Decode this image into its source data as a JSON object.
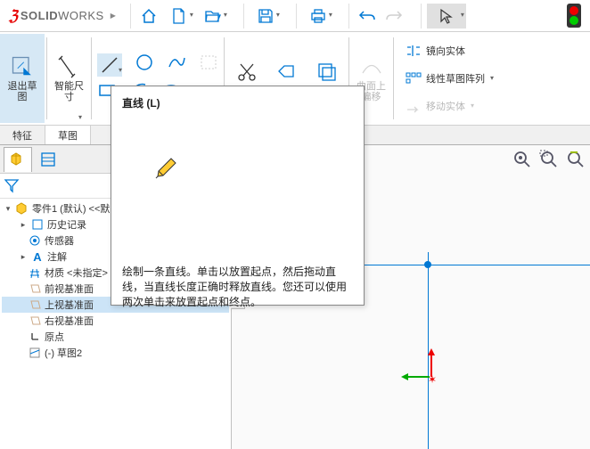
{
  "app": {
    "name_solid": "SOLID",
    "name_works": "WORKS"
  },
  "ribbon": {
    "exit_sketch": "退出草\n图",
    "smart_dim": "智能尺\n寸",
    "trim": "剪裁实",
    "convert": "转换实",
    "offset": "等距实",
    "curve_on_surface": "曲面上\n偏移",
    "mirror": "镜向实体",
    "linear_pattern": "线性草图阵列",
    "move": "移动实体"
  },
  "tabs": {
    "feature": "特征",
    "sketch": "草图"
  },
  "tooltip": {
    "title": "直线   (L)",
    "desc": "绘制一条直线。单击以放置起点，然后拖动直线，当直线长度正确时释放直线。您还可以使用两次单击来放置起点和终点。"
  },
  "tree": {
    "root": "零件1 (默认) <<默",
    "history": "历史记录",
    "sensors": "传感器",
    "annotations": "注解",
    "material": "材质 <未指定>",
    "front_plane": "前视基准面",
    "top_plane": "上视基准面",
    "right_plane": "右视基准面",
    "origin": "原点",
    "sketch2": "(-) 草图2"
  }
}
